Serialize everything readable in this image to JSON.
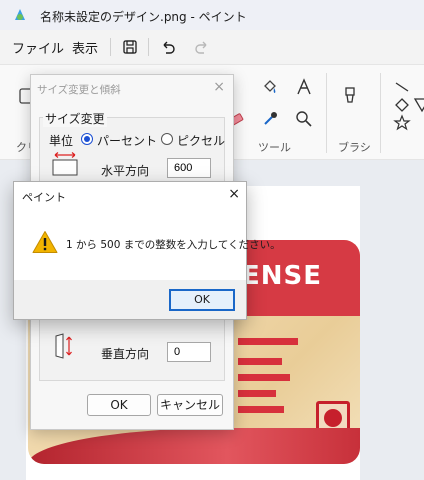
{
  "window": {
    "title": "名称未設定のデザイン.png - ペイント"
  },
  "menu": {
    "file": "ファイル",
    "view": "表示"
  },
  "ribbon": {
    "tools_label": "ツール",
    "brushes_label": "ブラシ",
    "clip_label": "クリ"
  },
  "card": {
    "title": "ENSE"
  },
  "resize_dialog": {
    "title": "サイズ変更と傾斜",
    "resize_group": "サイズ変更",
    "unit_label": "単位",
    "percent_label": "パーセント",
    "pixel_label": "ピクセル",
    "horizontal_label": "水平方向",
    "horizontal_value": "600",
    "vertical_label": "垂直方向",
    "vertical_value": "0",
    "ok_label": "OK",
    "cancel_label": "キャンセル"
  },
  "message_box": {
    "title": "ペイント",
    "message": "1 から 500 までの整数を入力してください。",
    "ok_label": "OK",
    "close_icon": "×"
  },
  "colors": {
    "accent": "#1a67c8",
    "card_red": "#d63a44",
    "warning": "#f2b400"
  }
}
